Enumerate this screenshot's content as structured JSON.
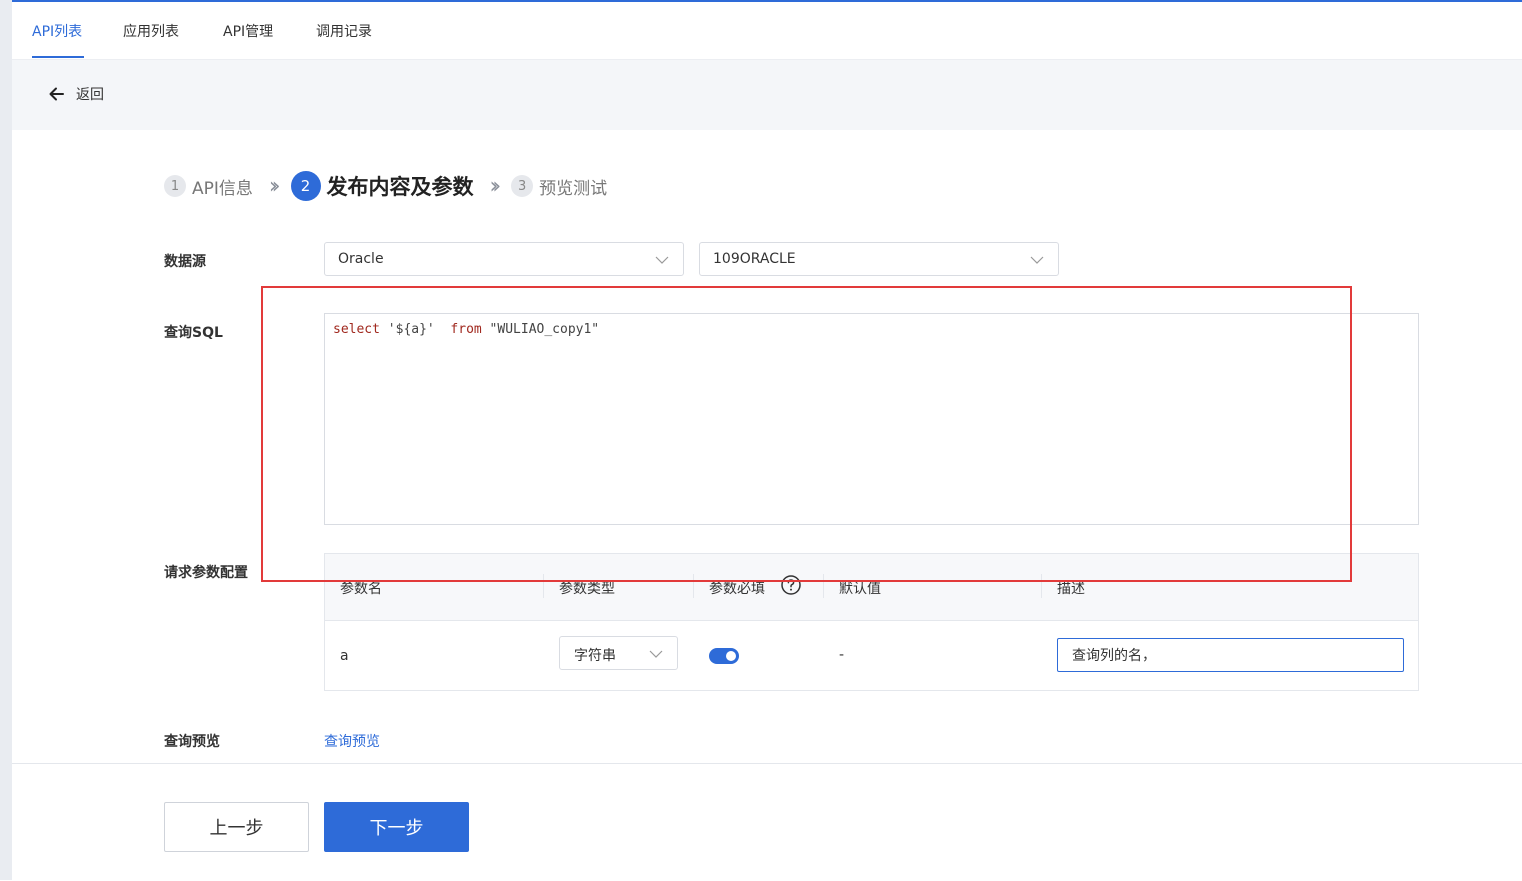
{
  "nav": {
    "tabs": [
      {
        "label": "API列表"
      },
      {
        "label": "应用列表"
      },
      {
        "label": "API管理"
      },
      {
        "label": "调用记录"
      }
    ]
  },
  "back": {
    "label": "返回"
  },
  "steps": [
    {
      "num": "1",
      "label": "API信息"
    },
    {
      "num": "2",
      "label": "发布内容及参数"
    },
    {
      "num": "3",
      "label": "预览测试"
    }
  ],
  "form": {
    "datasource_label": "数据源",
    "datasource_type": "Oracle",
    "datasource_name": "109ORACLE",
    "sql_label": "查询SQL",
    "sql": {
      "kw_select": "select",
      "part1": " '${a}'  ",
      "kw_from": "from",
      "part2": " \"WULIAO_copy1\""
    },
    "params_label": "请求参数配置",
    "preview_label": "查询预览",
    "preview_link": "查询预览"
  },
  "params_table": {
    "headers": {
      "name": "参数名",
      "type": "参数类型",
      "required": "参数必填",
      "default": "默认值",
      "description": "描述"
    },
    "rows": [
      {
        "name": "a",
        "type": "字符串",
        "required": true,
        "default": "-",
        "description": "查询列的名，"
      }
    ]
  },
  "footer": {
    "prev": "上一步",
    "next": "下一步"
  },
  "colors": {
    "accent": "#2e6bd8",
    "highlight_box": "#e23a3a"
  }
}
